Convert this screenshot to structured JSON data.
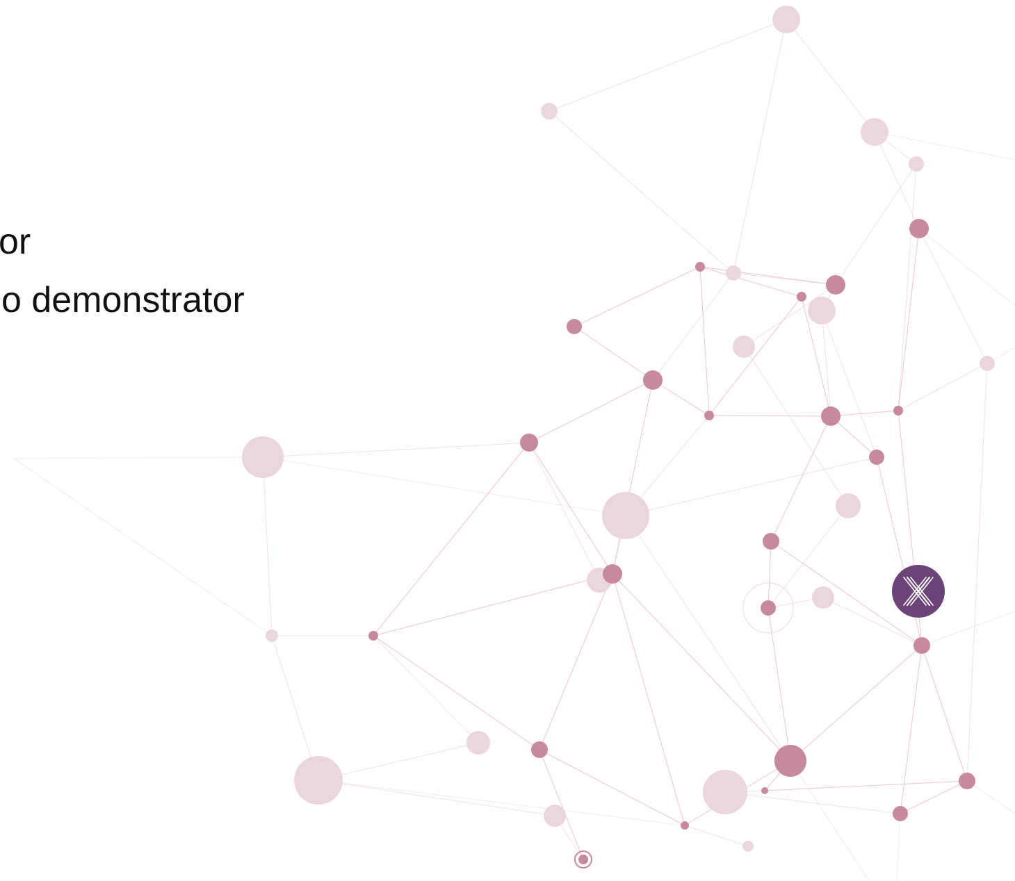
{
  "slide": {
    "text_lines": [
      "or",
      "o demonstrator"
    ]
  },
  "colors": {
    "node_strong": "#c78a9c",
    "node_faint": "#ecd6dd",
    "edge": "#e3bcc8",
    "logo_badge": "#6b4378",
    "text": "#111111"
  },
  "icons": {
    "logo": "x-logo-icon"
  }
}
